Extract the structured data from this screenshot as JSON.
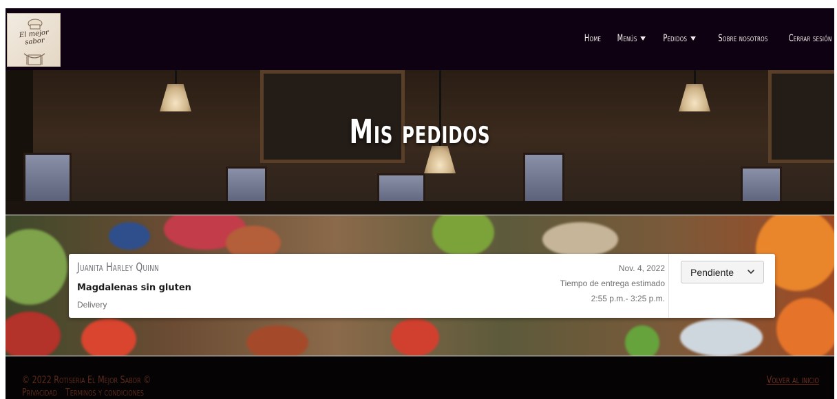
{
  "brand": {
    "logo_text": "El mejor sabor"
  },
  "nav": {
    "items": [
      {
        "label": "Home"
      },
      {
        "label": "Menús"
      },
      {
        "label": "Pedidos"
      },
      {
        "label": "Sobre nosotros"
      },
      {
        "label": "Cerrar sesión"
      }
    ]
  },
  "hero": {
    "title": "Mis pedidos"
  },
  "order": {
    "customer": "Juanita Harley Quinn",
    "product": "Magdalenas sin gluten",
    "delivery_type": "Delivery",
    "date": "Nov. 4, 2022",
    "eta_label": "Tiempo de entrega estimado",
    "eta_range": "2:55 p.m.- 3:25 p.m.",
    "status": "Pendiente"
  },
  "footer": {
    "copyright": "© 2022 Rotiseria El Mejor Sabor ©",
    "privacy": "Privacidad",
    "terms": "Terminos y condiciones",
    "back_link": "Volver al inicio"
  },
  "colors": {
    "navbar_bg": "#0e0111",
    "footer_bg": "#050304",
    "footer_text": "#5a2a1b"
  }
}
